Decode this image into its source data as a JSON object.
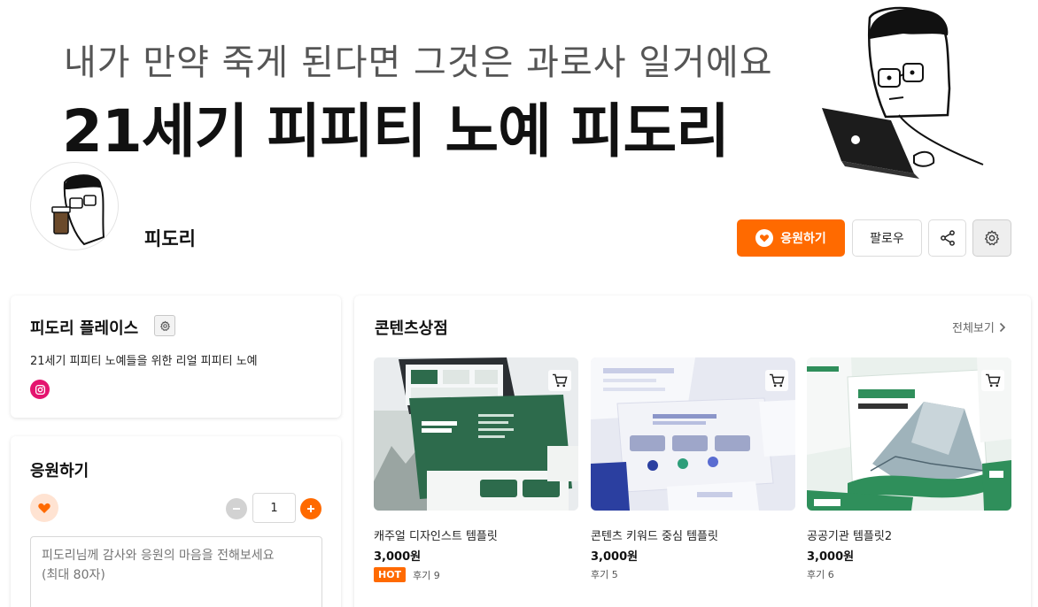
{
  "banner": {
    "subtitle": "내가 만약 죽게 된다면 그것은 과로사 일거에요",
    "title": "21세기 피피티 노예 피도리"
  },
  "profile": {
    "name": "피도리",
    "actions": {
      "support_label": "응원하기",
      "follow_label": "팔로우"
    }
  },
  "place": {
    "title": "피도리 플레이스",
    "description": "21세기 피피티 노예들을 위한 리얼 피피티 노예",
    "social": [
      "instagram-icon"
    ]
  },
  "donate": {
    "title": "응원하기",
    "quantity": "1",
    "message_placeholder": "피도리님께 감사와 응원의 마음을 전해보세요\n(최대 80자)"
  },
  "store": {
    "title": "콘텐츠상점",
    "view_all": "전체보기",
    "products": [
      {
        "name": "캐주얼 디자인스트 템플릿",
        "price": "3,000원",
        "badge": "HOT",
        "reviews": "후기 9"
      },
      {
        "name": "콘텐츠 키워드 중심 템플릿",
        "price": "3,000원",
        "badge": "",
        "reviews": "후기 5"
      },
      {
        "name": "공공기관 템플릿2",
        "price": "3,000원",
        "badge": "",
        "reviews": "후기 6"
      }
    ]
  },
  "colors": {
    "accent": "#ff6a00",
    "instagram": "#e4146f",
    "template_green": "#2d6b4c",
    "template_blue": "#2b3fa0"
  }
}
